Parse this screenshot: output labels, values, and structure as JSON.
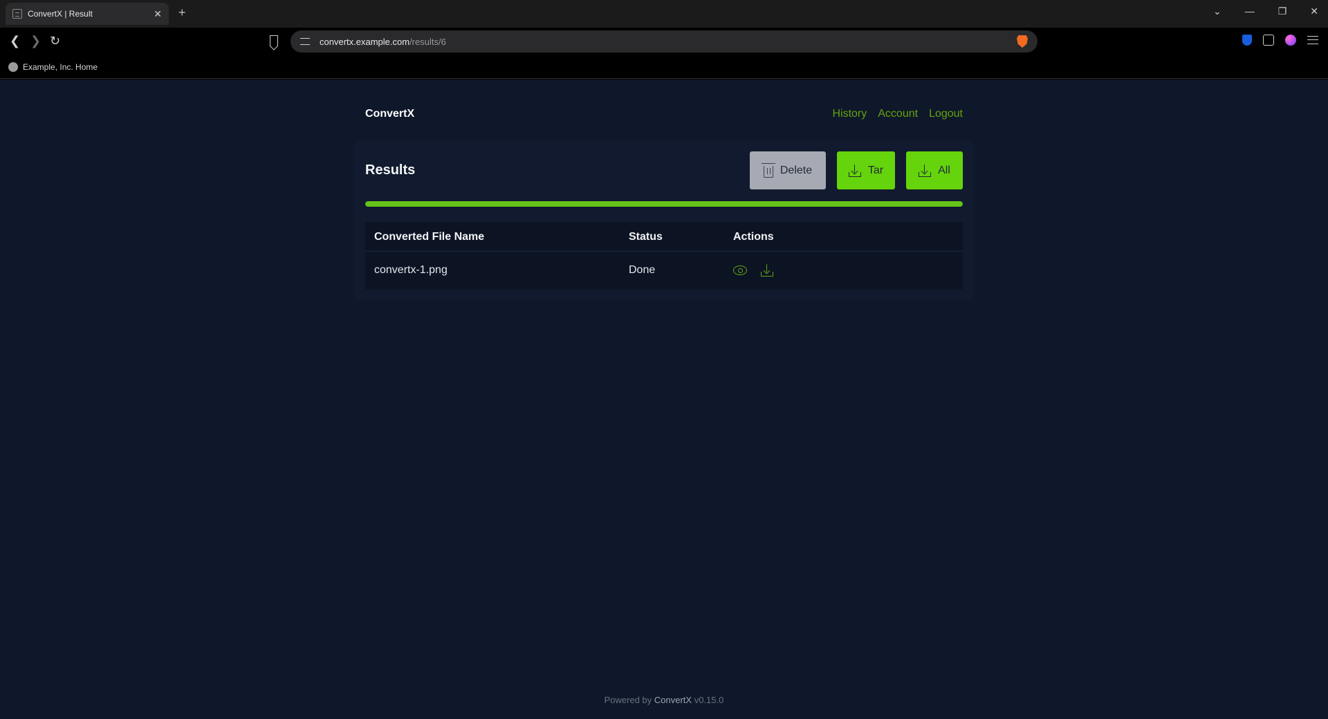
{
  "browser": {
    "tab_title": "ConvertX | Result",
    "tab_close": "✕",
    "new_tab": "+",
    "window_controls": [
      "⌄",
      "—",
      "❐",
      "✕"
    ],
    "url_host": "convertx.example.com",
    "url_path": "/results/6",
    "bookmark_label": "Example, Inc. Home"
  },
  "header": {
    "logo": "ConvertX",
    "nav": [
      "History",
      "Account",
      "Logout"
    ]
  },
  "results": {
    "title": "Results",
    "delete_label": "Delete",
    "tar_label": "Tar",
    "all_label": "All",
    "progress_percent": 100
  },
  "table": {
    "columns": [
      "Converted File Name",
      "Status",
      "Actions"
    ],
    "rows": [
      {
        "file_name": "convertx-1.png",
        "status": "Done"
      }
    ]
  },
  "footer": {
    "prefix": "Powered by",
    "brand": "ConvertX",
    "version": "v0.15.0"
  },
  "colors": {
    "accent": "#65a30d",
    "button_green": "#65d40c",
    "background": "#0f172a"
  },
  "icons": [
    "back-icon",
    "forward-icon",
    "reload-icon",
    "bookmark-icon",
    "site-info-icon",
    "brave-shield-icon",
    "trash-icon",
    "download-icon",
    "eye-icon"
  ]
}
